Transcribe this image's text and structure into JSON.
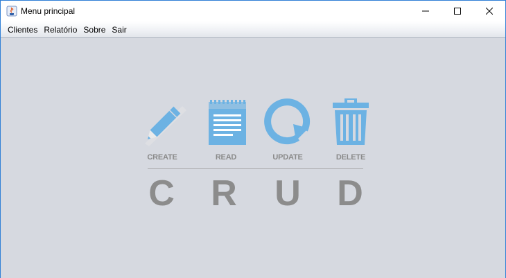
{
  "window": {
    "title": "Menu principal",
    "app_icon": "java-cup-icon",
    "controls": [
      "minimize-icon",
      "maximize-icon",
      "close-icon"
    ]
  },
  "menubar": {
    "items": [
      "Clientes",
      "Relatório",
      "Sobre",
      "Sair"
    ]
  },
  "crud_logo": {
    "operations": [
      {
        "label": "CREATE",
        "letter": "C",
        "icon": "pencil-icon"
      },
      {
        "label": "READ",
        "letter": "R",
        "icon": "notepad-icon"
      },
      {
        "label": "UPDATE",
        "letter": "U",
        "icon": "refresh-icon"
      },
      {
        "label": "DELETE",
        "letter": "D",
        "icon": "trash-icon"
      }
    ],
    "icon_color": "#6cb2e3",
    "text_color": "#8c8c8c"
  }
}
